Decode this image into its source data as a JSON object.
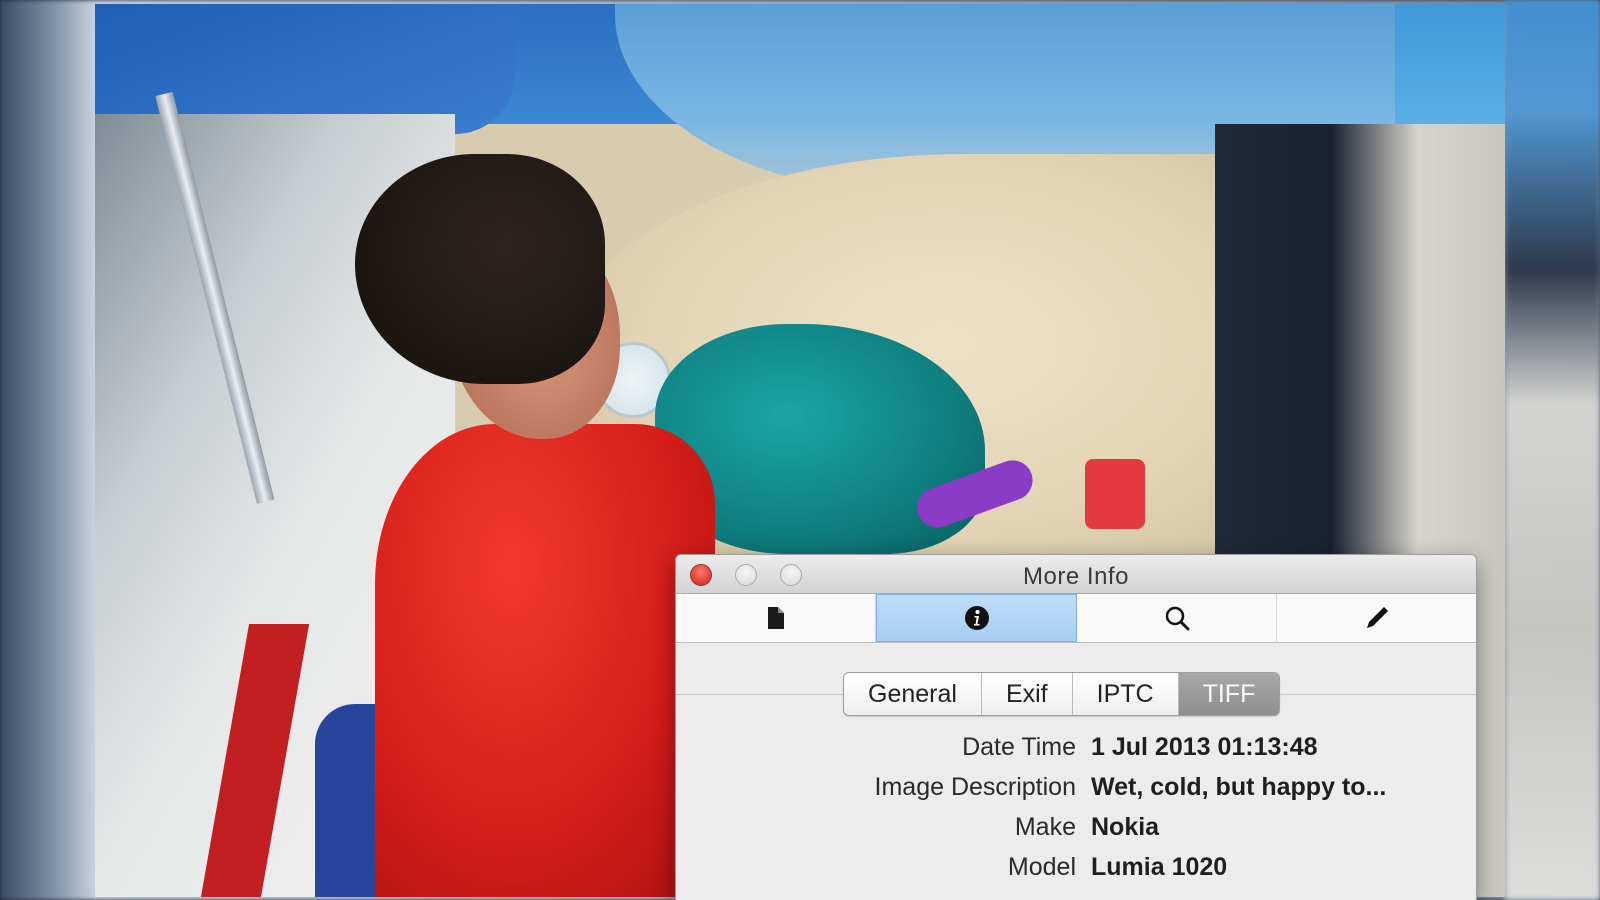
{
  "window": {
    "title": "More Info",
    "toolbar": [
      {
        "icon": "document-icon",
        "active": false
      },
      {
        "icon": "info-icon",
        "active": true
      },
      {
        "icon": "magnifier-icon",
        "active": false
      },
      {
        "icon": "pencil-icon",
        "active": false
      }
    ],
    "tabs": [
      {
        "label": "General",
        "selected": false
      },
      {
        "label": "Exif",
        "selected": false
      },
      {
        "label": "IPTC",
        "selected": false
      },
      {
        "label": "TIFF",
        "selected": true
      }
    ],
    "properties": [
      {
        "label": "Date Time",
        "value": "1 Jul 2013 01:13:48"
      },
      {
        "label": "Image Description",
        "value": "Wet, cold, but happy to..."
      },
      {
        "label": "Make",
        "value": "Nokia"
      },
      {
        "label": "Model",
        "value": "Lumia 1020"
      }
    ]
  },
  "colors": {
    "close": "#e0443a",
    "active_tool": "#a7cdf3",
    "selected_tab": "#8e8e8e"
  }
}
